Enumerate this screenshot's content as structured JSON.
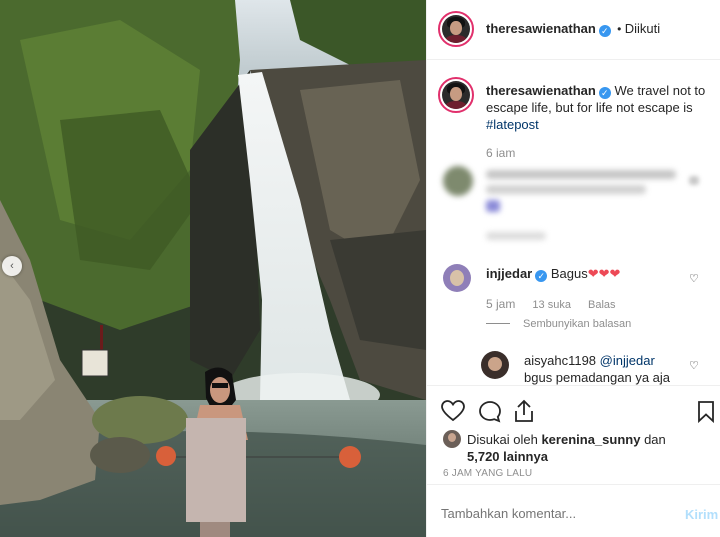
{
  "post": {
    "username": "theresawienathan",
    "follow_status": "Diikuti",
    "separator": "•"
  },
  "caption": {
    "username": "theresawienathan",
    "text": "We travel not to escape life, but for life not escape is",
    "hashtag": "#latepost",
    "time": "6 iam"
  },
  "comments": [
    {
      "username": "injjedar",
      "text": "Bagus",
      "emoji": "❤❤❤",
      "time": "5 jam",
      "likes": "13 suka",
      "reply_label": "Balas",
      "hide_replies_label": "Sembunyikan balasan"
    },
    {
      "username": "aisyahc1198",
      "mention": "@injjedar",
      "text": "bgus pemadangan ya aja"
    }
  ],
  "likes": {
    "prefix": "Disukai oleh",
    "user": "kerenina_sunny",
    "joiner": "dan",
    "count": "5,720 lainnya"
  },
  "timestamp": "6 JAM YANG LALU",
  "add_comment": {
    "placeholder": "Tambahkan komentar...",
    "post_label": "Kirim"
  },
  "icons": {
    "heart": "heart-icon",
    "comment": "comment-icon",
    "share": "share-icon",
    "save": "bookmark-icon"
  },
  "colors": {
    "verified": "#3897f0",
    "link": "#003569",
    "muted": "#8e8e8e",
    "heart_red": "#ed4956",
    "post_disabled": "#b2dffc"
  }
}
